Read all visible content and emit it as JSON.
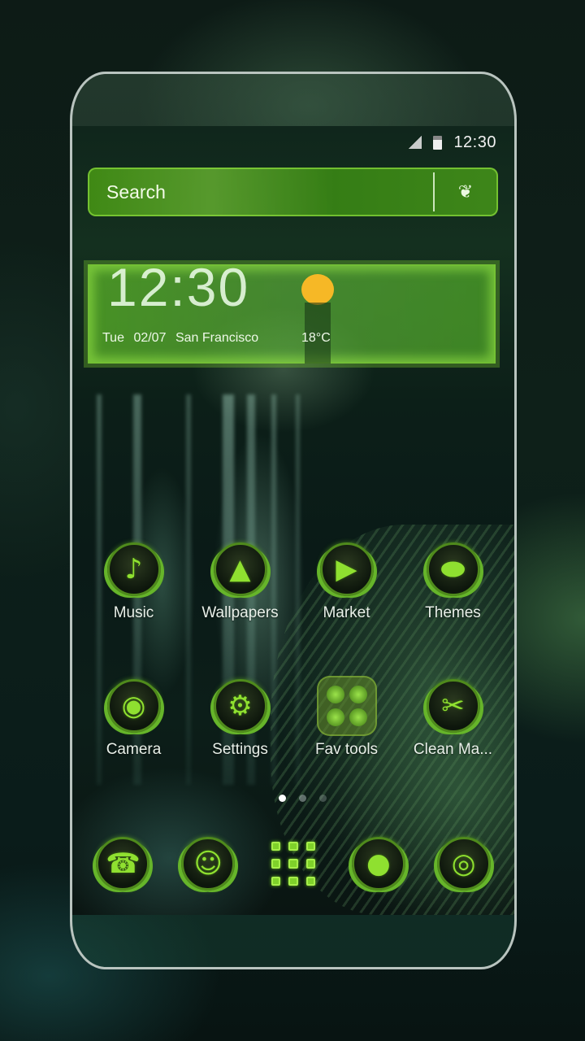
{
  "status_bar": {
    "time": "12:30",
    "icons": [
      "signal-icon",
      "battery-icon"
    ]
  },
  "search": {
    "placeholder": "Search",
    "icon": "maple-leaf-icon",
    "icon_glyph": "❦"
  },
  "clock_widget": {
    "time": "12:30",
    "day": "Tue",
    "date": "02/07",
    "city": "San Francisco",
    "temperature": "18°C",
    "weather_icon": "sun-icon"
  },
  "apps": [
    {
      "label": "Music",
      "icon": "music-note-icon",
      "glyph": "♪"
    },
    {
      "label": "Wallpapers",
      "icon": "mountain-image-icon",
      "glyph": "▲"
    },
    {
      "label": "Market",
      "icon": "shopping-bag-play-icon",
      "glyph": "▶"
    },
    {
      "label": "Themes",
      "icon": "palette-icon",
      "glyph": "⬬"
    },
    {
      "label": "Camera",
      "icon": "camera-icon",
      "glyph": "◉"
    },
    {
      "label": "Settings",
      "icon": "gear-icon",
      "glyph": "⚙"
    },
    {
      "label": "Fav tools",
      "icon": "folder-icon",
      "glyph": ""
    },
    {
      "label": "Clean Ma...",
      "icon": "broom-icon",
      "glyph": "✂"
    }
  ],
  "page_indicator": {
    "pages": 3,
    "active": 1
  },
  "dock": [
    {
      "name": "phone",
      "icon": "phone-icon",
      "glyph": "☎"
    },
    {
      "name": "contacts",
      "icon": "contacts-icon",
      "glyph": "☺"
    },
    {
      "name": "app-drawer",
      "icon": "app-drawer-icon",
      "glyph": ""
    },
    {
      "name": "messages",
      "icon": "chat-bubbles-icon",
      "glyph": "●"
    },
    {
      "name": "browser",
      "icon": "globe-icon",
      "glyph": "◎"
    }
  ],
  "colors": {
    "accent_green": "#7fd12a",
    "sun_yellow": "#f6b826",
    "frame_outline": "#b9c4bf"
  }
}
